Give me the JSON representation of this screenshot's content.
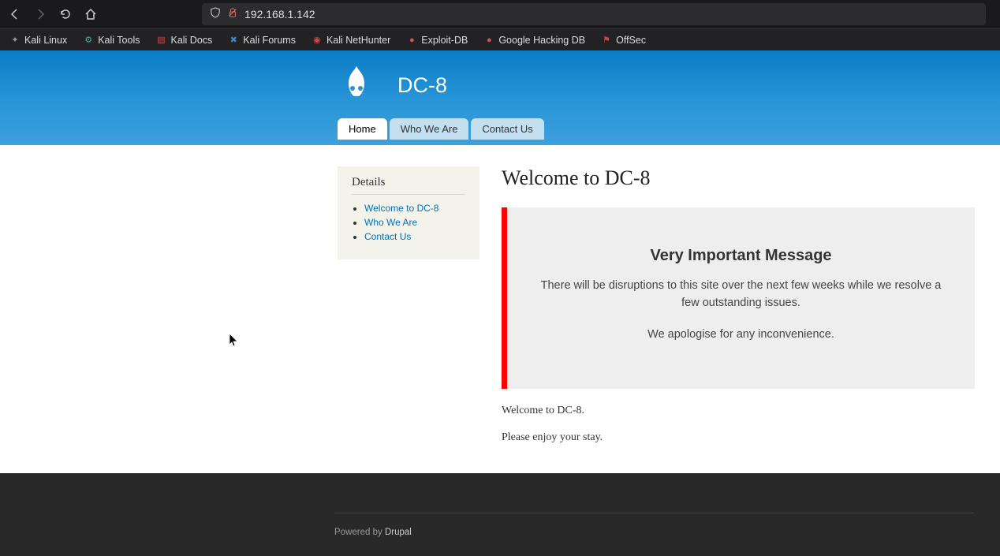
{
  "browser": {
    "url": "192.168.1.142",
    "bookmarks": [
      {
        "label": "Kali Linux",
        "icon_color": "#333"
      },
      {
        "label": "Kali Tools",
        "icon_color": "#2a7fff"
      },
      {
        "label": "Kali Docs",
        "icon_color": "#d63f3f"
      },
      {
        "label": "Kali Forums",
        "icon_color": "#3b8bd8"
      },
      {
        "label": "Kali NetHunter",
        "icon_color": "#d63f3f"
      },
      {
        "label": "Exploit-DB",
        "icon_color": "#c75050"
      },
      {
        "label": "Google Hacking DB",
        "icon_color": "#c75050"
      },
      {
        "label": "OffSec",
        "icon_color": "#ce3b3b"
      }
    ]
  },
  "site": {
    "title": "DC-8",
    "tabs": [
      {
        "label": "Home",
        "active": true
      },
      {
        "label": "Who We Are",
        "active": false
      },
      {
        "label": "Contact Us",
        "active": false
      }
    ]
  },
  "sidebar": {
    "heading": "Details",
    "links": [
      {
        "label": "Welcome to DC-8"
      },
      {
        "label": "Who We Are"
      },
      {
        "label": "Contact Us"
      }
    ]
  },
  "main": {
    "title": "Welcome to DC-8",
    "alert_heading": "Very Important Message",
    "alert_line1": "There will be disruptions to this site over the next few weeks while we resolve a few outstanding issues.",
    "alert_line2": "We apologise for any inconvenience.",
    "body_p1": "Welcome to DC-8.",
    "body_p2": "Please enjoy your stay."
  },
  "footer": {
    "prefix": "Powered by ",
    "link": "Drupal"
  }
}
